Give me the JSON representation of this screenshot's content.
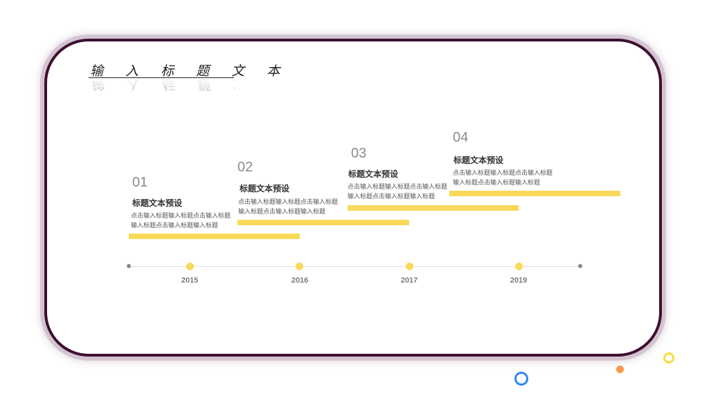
{
  "title": "输 入 标 题 文 本",
  "steps": [
    {
      "num": "01",
      "heading": "标题文本预设",
      "desc": "点击输入标题输入标题点击输入标题输入标题点击输入标题输入标题"
    },
    {
      "num": "02",
      "heading": "标题文本预设",
      "desc": "点击输入标题输入标题点击输入标题输入标题点击输入标题输入标题"
    },
    {
      "num": "03",
      "heading": "标题文本预设",
      "desc": "点击输入标题输入标题点击输入标题输入标题点击输入标题输入标题"
    },
    {
      "num": "04",
      "heading": "标题文本预设",
      "desc": "点击输入标题输入标题点击输入标题输入标题点击输入标题输入标题"
    }
  ],
  "years": [
    "2015",
    "2016",
    "2017",
    "2019"
  ],
  "colors": {
    "frame": "#3d0f2e",
    "accent_bar": "#f8d95a",
    "axis_end_dot": "#7c9088",
    "deco_blue": "#2f86f3",
    "deco_orange": "#f7984a",
    "deco_yellow": "#f8dd3f"
  }
}
